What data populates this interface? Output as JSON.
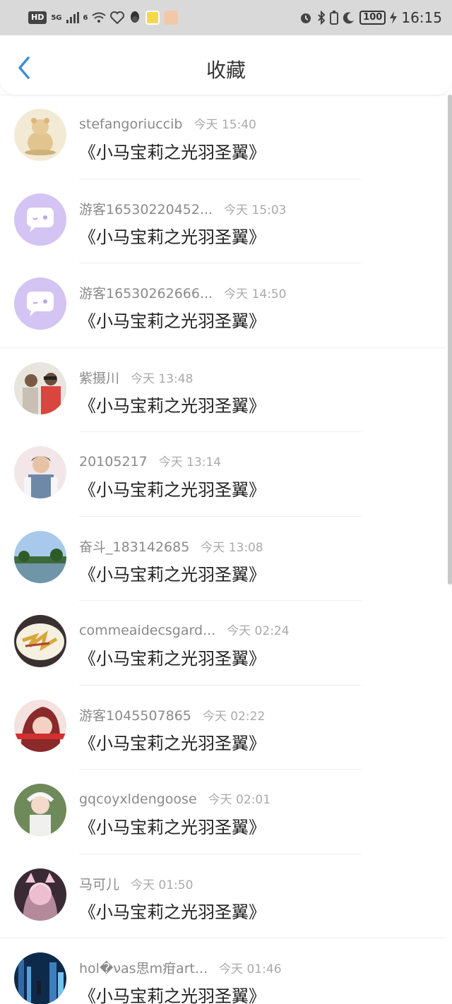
{
  "status_bar": {
    "hd": "HD",
    "net1": "5G",
    "net2": "6",
    "battery": "100",
    "time": "16:15"
  },
  "header": {
    "title": "收藏",
    "back_icon": "chevron-left-icon"
  },
  "colors": {
    "accent": "#3d8fd6",
    "status_bar_bg": "#d9d9d9",
    "username": "#8a8a8a",
    "timestamp": "#aaaaaa"
  },
  "items": [
    {
      "name": "stefangoriuccib",
      "time": "今天 15:40",
      "title": "《小马宝莉之光羽圣翼》",
      "avatar": "bear-illustration"
    },
    {
      "name": "游客16530220452...",
      "time": "今天 15:03",
      "title": "《小马宝莉之光羽圣翼》",
      "avatar": "default-chat-bubble"
    },
    {
      "name": "游客16530262666...",
      "time": "今天 14:50",
      "title": "《小马宝莉之光羽圣翼》",
      "avatar": "default-chat-bubble"
    },
    {
      "name": "紫摄川",
      "time": "今天 13:48",
      "title": "《小马宝莉之光羽圣翼》",
      "avatar": "two-people-photo"
    },
    {
      "name": "20105217",
      "time": "今天 13:14",
      "title": "《小马宝莉之光羽圣翼》",
      "avatar": "person-photo"
    },
    {
      "name": "奋斗_183142685",
      "time": "今天 13:08",
      "title": "《小马宝莉之光羽圣翼》",
      "avatar": "landscape-photo"
    },
    {
      "name": "commeaidecsgard...",
      "time": "今天 02:24",
      "title": "《小马宝莉之光羽圣翼》",
      "avatar": "food-photo"
    },
    {
      "name": "游客1045507865",
      "time": "今天 02:22",
      "title": "《小马宝莉之光羽圣翼》",
      "avatar": "girl-photo"
    },
    {
      "name": "gqcoyxldengoose",
      "time": "今天 02:01",
      "title": "《小马宝莉之光羽圣翼》",
      "avatar": "child-photo"
    },
    {
      "name": "马可儿",
      "time": "今天 01:50",
      "title": "《小马宝莉之光羽圣翼》",
      "avatar": "anime-girl"
    },
    {
      "name": "hol�νas思m疳art...",
      "time": "今天 01:46",
      "title": "《小马宝莉之光羽圣翼》",
      "avatar": "city-night"
    }
  ]
}
